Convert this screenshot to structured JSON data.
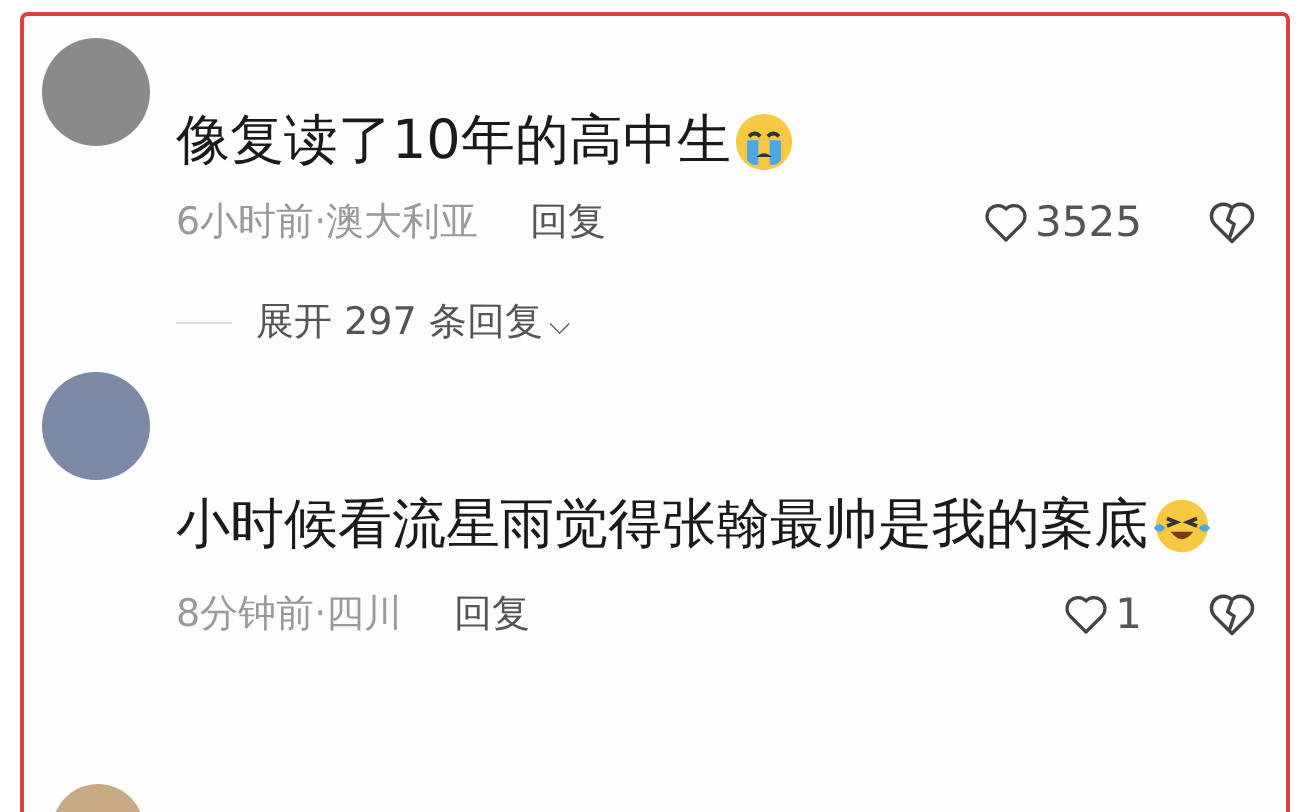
{
  "comments": [
    {
      "text": "像复读了10年的高中生",
      "emoji": {
        "kind": "crying"
      },
      "time": "6小时前·澳大利亚",
      "reply": "回复",
      "likes": "3525",
      "expand": "展开 297 条回复",
      "expand_icon": "⌵"
    },
    {
      "text": "小时候看流星雨觉得张翰最帅是我的案底",
      "emoji": {
        "kind": "laughing"
      },
      "time": "8分钟前·四川",
      "reply": "回复",
      "likes": "1"
    }
  ]
}
